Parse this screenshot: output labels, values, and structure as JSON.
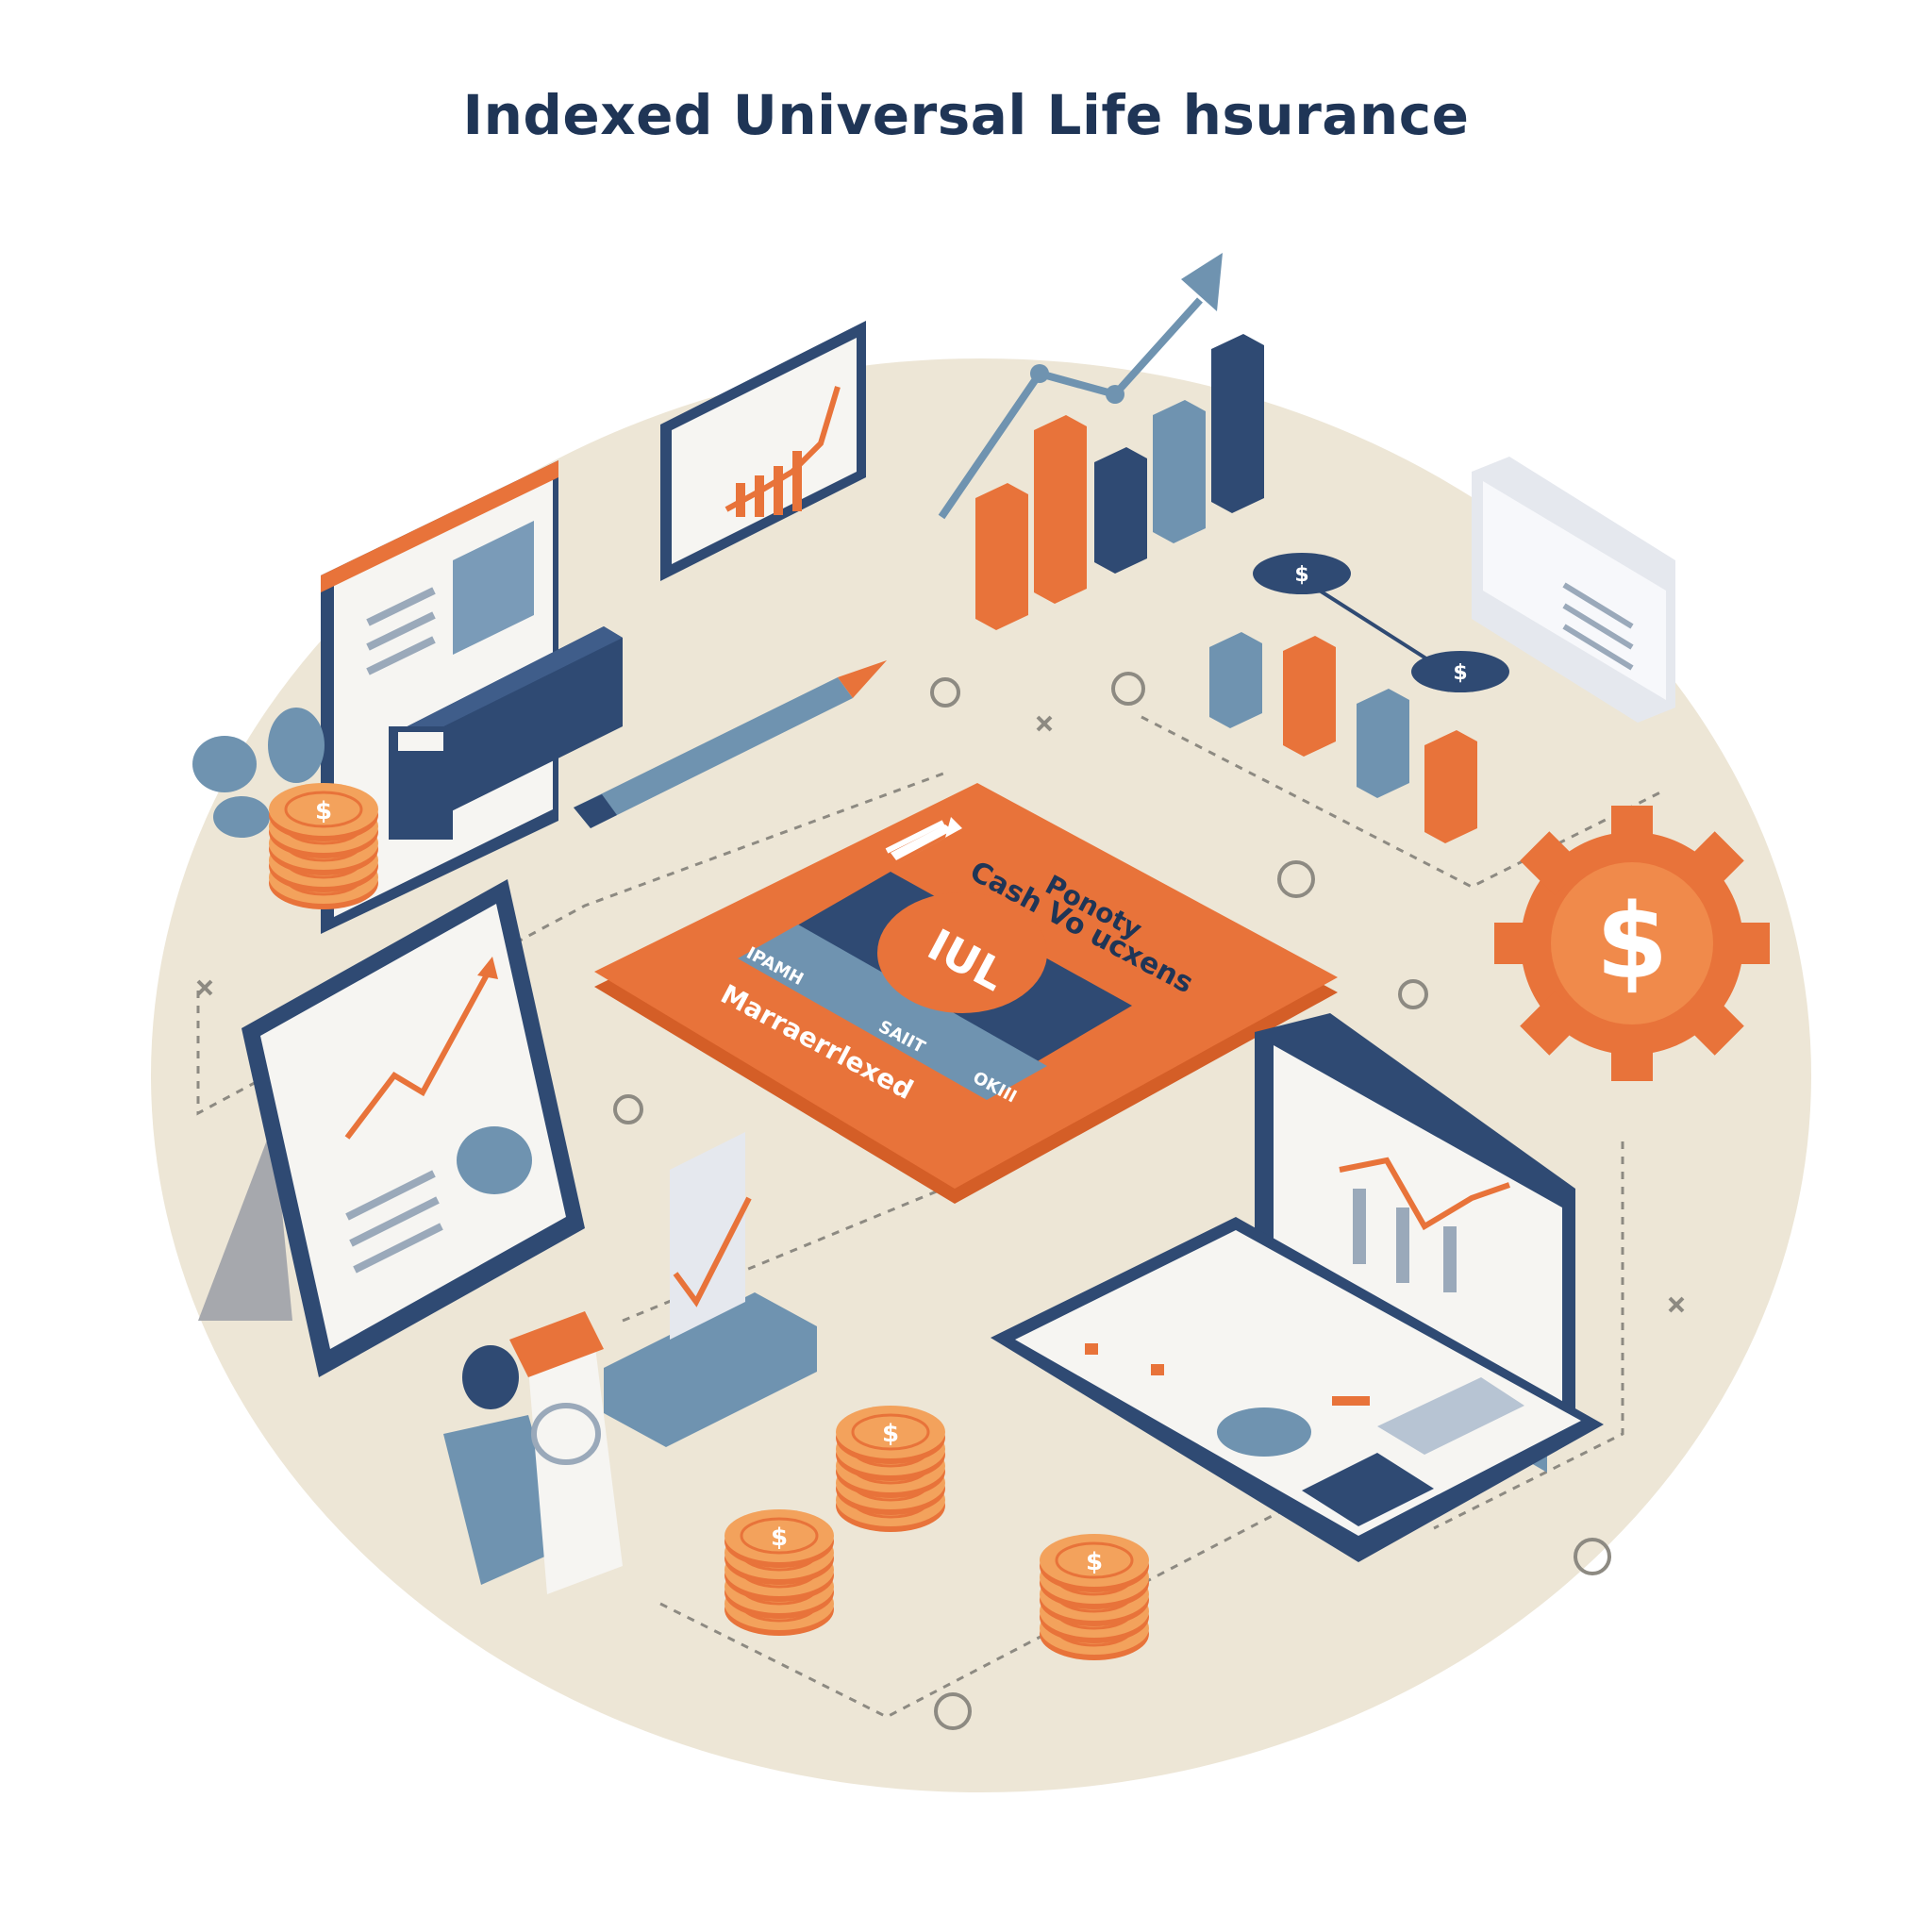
{
  "title": "Indexed Universal Life hsurance",
  "card": {
    "line1": "Ponoty",
    "line2": "Cash Vo ucxens",
    "badge": "IUL",
    "strip_left": "IPAMH",
    "strip_mid": "SAIIT",
    "strip_right": "OKIII",
    "bottom": "Marraerrlexed"
  },
  "colors": {
    "navy": "#2f4a73",
    "orange": "#e8733a",
    "steel": "#6f93b0",
    "cream": "#ede6d6",
    "ink": "#1f3556"
  },
  "icons": [
    "coin-stack-icon",
    "gear-dollar-icon",
    "bar-chart-icon",
    "trend-arrow-icon",
    "tablet-icon",
    "laptop-icon",
    "monitor-icon",
    "pencil-icon",
    "person-icon",
    "speech-bubble-icon",
    "plant-icon"
  ]
}
